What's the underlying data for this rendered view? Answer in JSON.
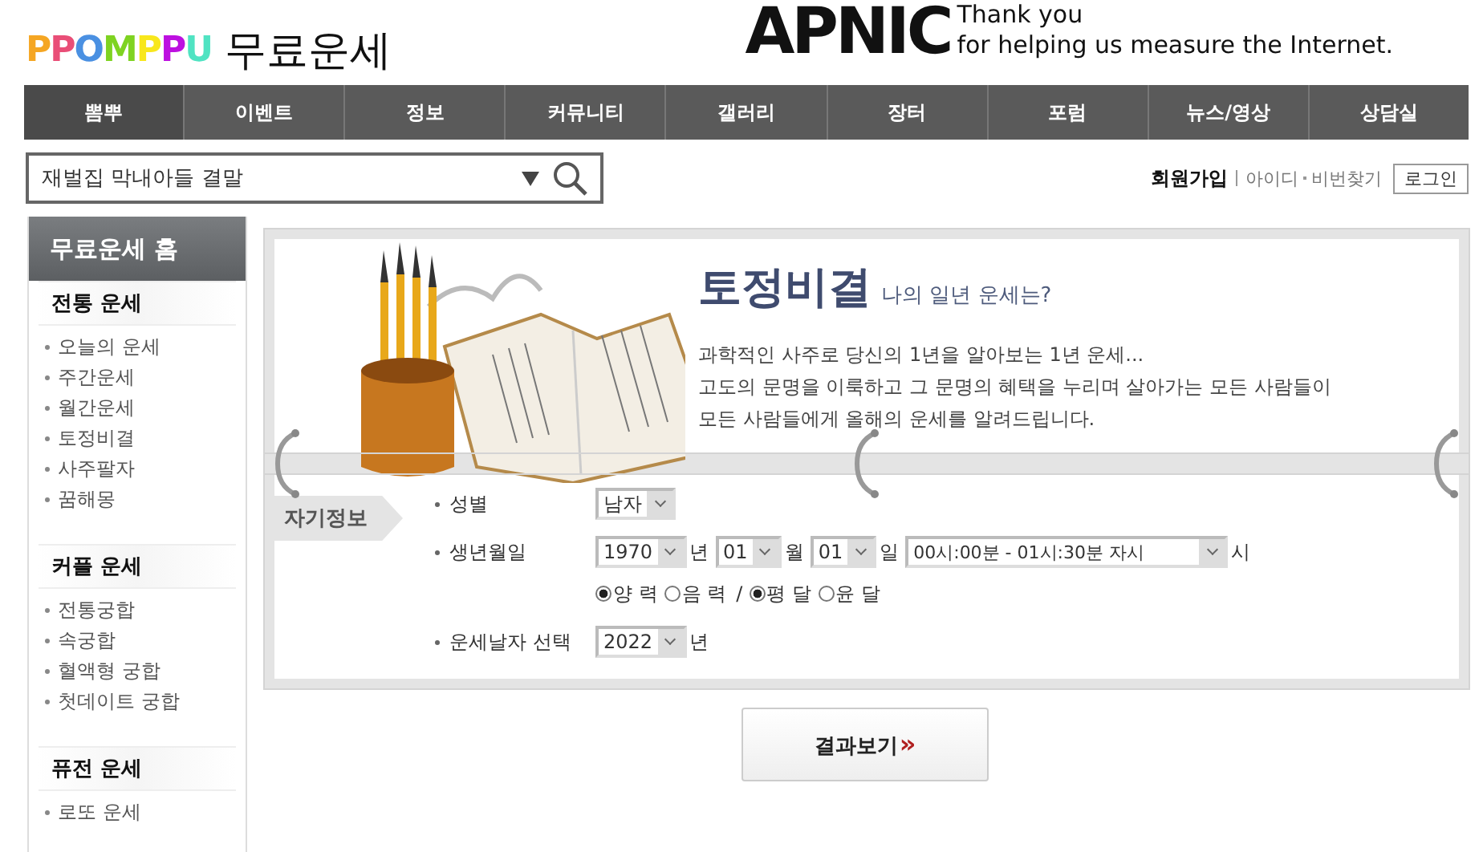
{
  "header": {
    "logo": "PPOMPPU",
    "site_title": "무료운세",
    "ad": {
      "brand": "APNIC",
      "line1": "Thank you",
      "line2": "for helping us measure the Internet."
    }
  },
  "nav": [
    {
      "label": "뽐뿌",
      "selected": true
    },
    {
      "label": "이벤트",
      "selected": false
    },
    {
      "label": "정보",
      "selected": false
    },
    {
      "label": "커뮤니티",
      "selected": false
    },
    {
      "label": "갤러리",
      "selected": false
    },
    {
      "label": "장터",
      "selected": false
    },
    {
      "label": "포럼",
      "selected": false
    },
    {
      "label": "뉴스/영상",
      "selected": false
    },
    {
      "label": "상담실",
      "selected": false
    }
  ],
  "search": {
    "value": "재벌집 막내아들 결말"
  },
  "account": {
    "join": "회원가입",
    "id": "아이디",
    "pw": "비번찾기",
    "login": "로그인"
  },
  "sidebar": {
    "home": "무료운세 홈",
    "sections": [
      {
        "title": "전통 운세",
        "items": [
          "오늘의 운세",
          "주간운세",
          "월간운세",
          "토정비결",
          "사주팔자",
          "꿈해몽"
        ]
      },
      {
        "title": "커플 운세",
        "items": [
          "전통궁합",
          "속궁합",
          "혈액형 궁합",
          "첫데이트 궁합"
        ]
      },
      {
        "title": "퓨전 운세",
        "items": [
          "로또 운세"
        ]
      }
    ]
  },
  "intro": {
    "title": "토정비결",
    "subtitle": "나의 일년 운세는?",
    "lines": [
      "과학적인 사주로 당신의 1년을 알아보는 1년 운세...",
      "고도의 문명을 이룩하고 그 문명의 혜택을 누리며 살아가는 모든 사람들이",
      "모든 사람들에게 올해의 운세를 알려드립니다."
    ]
  },
  "form": {
    "tab": "자기정보",
    "gender": {
      "label": "성별",
      "value": "남자"
    },
    "birth": {
      "label": "생년월일",
      "year": "1970",
      "year_unit": "년",
      "month": "01",
      "month_unit": "월",
      "day": "01",
      "day_unit": "일",
      "time": "00시:00분 - 01시:30분 자시",
      "time_unit": "시"
    },
    "calendar": [
      {
        "label": "양 력",
        "selected": true
      },
      {
        "label": "음 력",
        "selected": false
      }
    ],
    "separator": "/",
    "month_type": [
      {
        "label": "평 달",
        "selected": true
      },
      {
        "label": "윤 달",
        "selected": false
      }
    ],
    "target": {
      "label": "운세날자 선택",
      "year": "2022",
      "unit": "년"
    }
  },
  "submit": {
    "label": "결과보기",
    "arrow": "»"
  }
}
